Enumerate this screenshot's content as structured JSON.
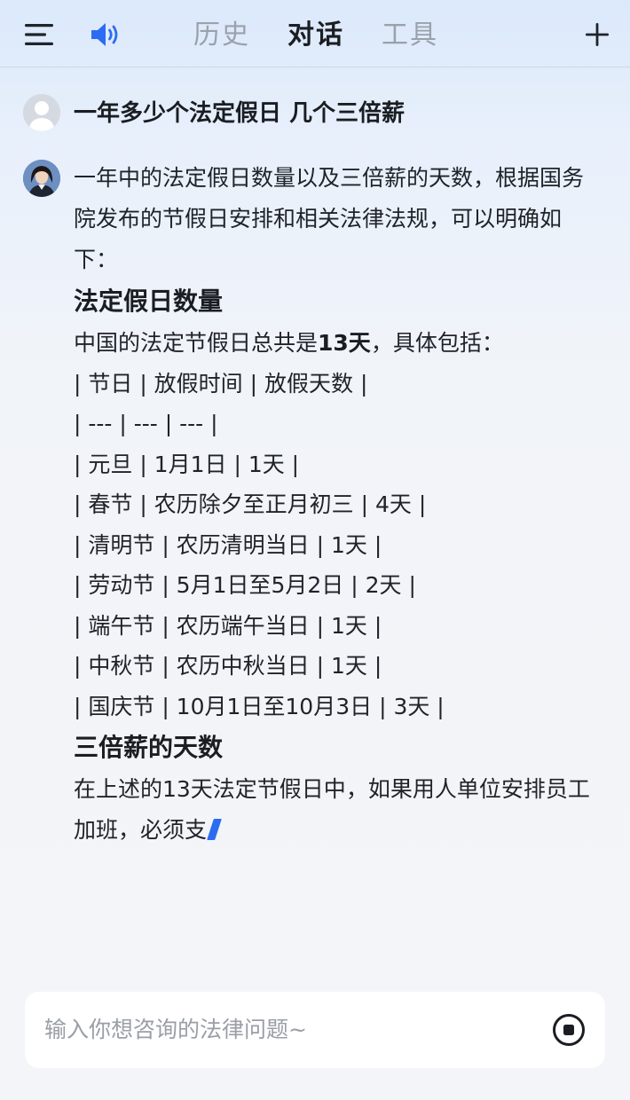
{
  "header": {
    "tabs": [
      {
        "label": "历史",
        "active": false
      },
      {
        "label": "对话",
        "active": true
      },
      {
        "label": "工具",
        "active": false
      }
    ],
    "icons": {
      "menu": "menu-icon",
      "speaker": "speaker-icon",
      "add": "plus-icon"
    },
    "accent_color": "#2b6cf3"
  },
  "conversation": {
    "user_message": "一年多少个法定假日 几个三倍薪",
    "answer": {
      "intro": "一年中的法定假日数量以及三倍薪的天数，根据国务院发布的节假日安排和相关法律法规，可以明确如下：",
      "heading1": "法定假日数量",
      "total_prefix": "中国的法定节假日总共是",
      "total_bold": "13天",
      "total_suffix": "，具体包括：",
      "table_lines": [
        "| 节日 | 放假时间 | 放假天数 |",
        "| --- | --- | --- |",
        "| 元旦 | 1月1日 | 1天 |",
        "| 春节 | 农历除夕至正月初三 | 4天 |",
        "| 清明节 | 农历清明当日 | 1天 |",
        "| 劳动节 | 5月1日至5月2日 | 2天 |",
        "| 端午节 | 农历端午当日 | 1天 |",
        "| 中秋节 | 农历中秋当日 | 1天 |",
        "| 国庆节 | 10月1日至10月3日 | 3天 |"
      ],
      "heading2": "三倍薪的天数",
      "closing": "在上述的13天法定节假日中，如果用人单位安排员工加班，必须支"
    }
  },
  "input": {
    "placeholder": "输入你想咨询的法律问题~",
    "value": "",
    "stop_icon": "stop-icon"
  }
}
